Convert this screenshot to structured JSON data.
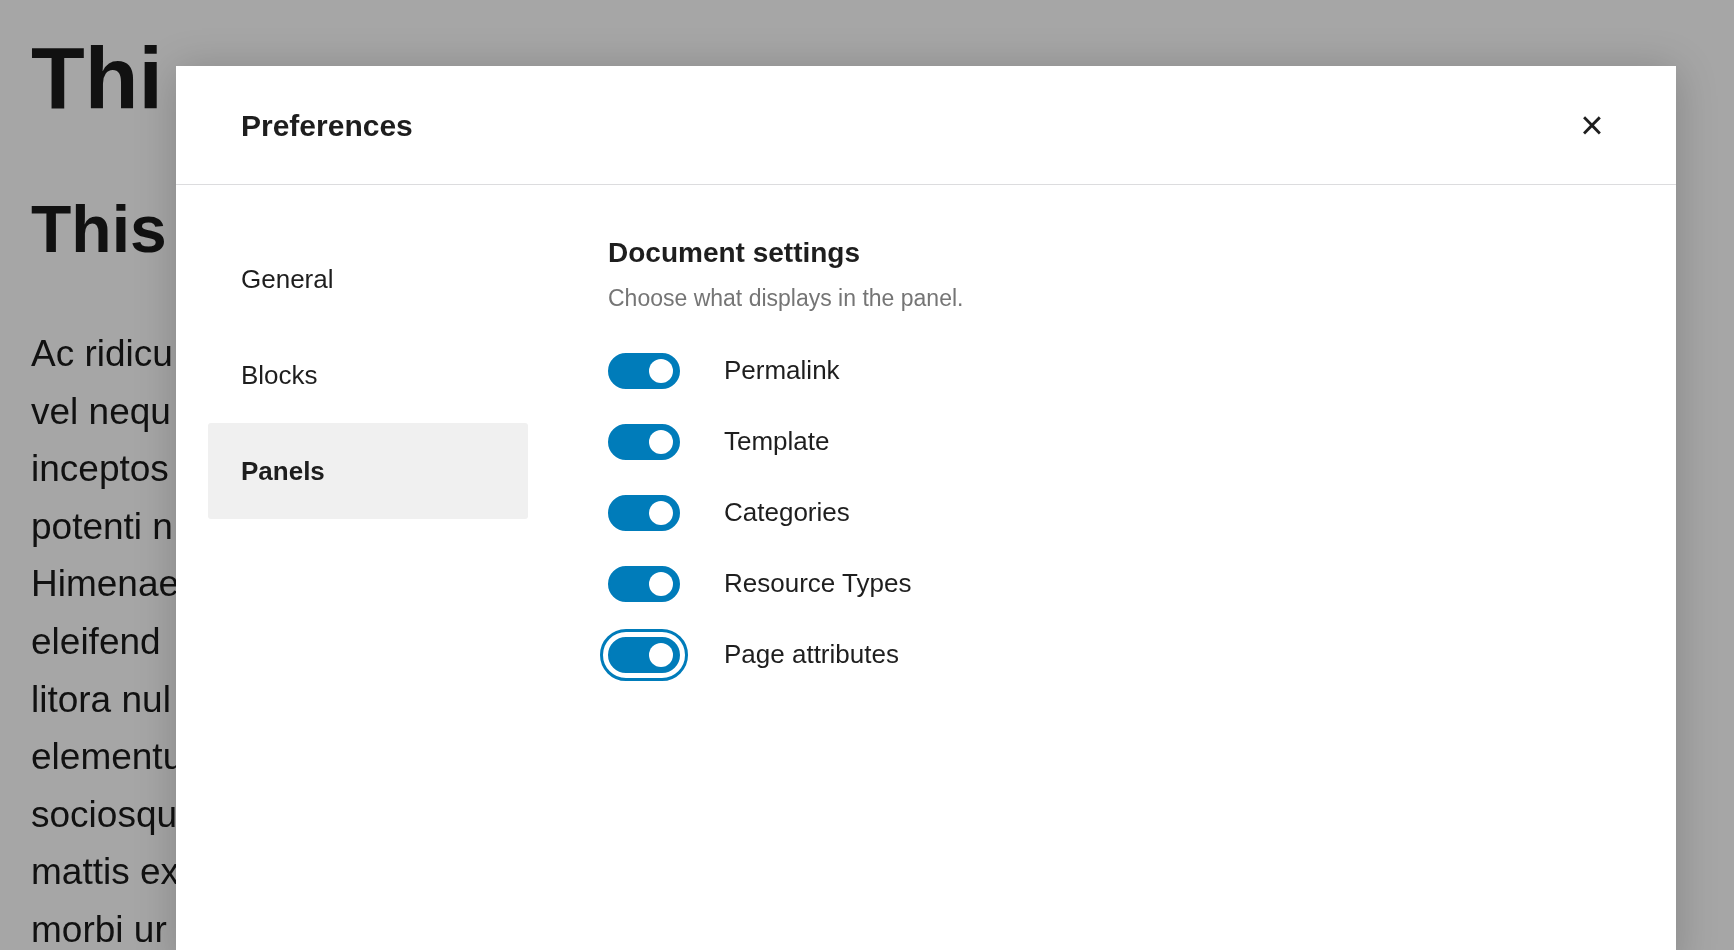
{
  "background_page": {
    "title": "Thi",
    "subtitle": "This",
    "paragraph_lines": [
      "Ac ridicu",
      "vel nequ",
      "inceptos",
      "potenti n",
      "Himenae",
      "eleifend",
      "litora nul",
      "elementu",
      "sociosqu",
      "mattis ex",
      "morbi ur"
    ]
  },
  "dialog": {
    "title": "Preferences",
    "close": "×",
    "tabs": [
      {
        "label": "General",
        "selected": false
      },
      {
        "label": "Blocks",
        "selected": false
      },
      {
        "label": "Panels",
        "selected": true
      }
    ],
    "section": {
      "heading": "Document settings",
      "description": "Choose what displays in the panel.",
      "toggles": [
        {
          "label": "Permalink",
          "on": true,
          "focused": false
        },
        {
          "label": "Template",
          "on": true,
          "focused": false
        },
        {
          "label": "Categories",
          "on": true,
          "focused": false
        },
        {
          "label": "Resource Types",
          "on": true,
          "focused": false
        },
        {
          "label": "Page attributes",
          "on": true,
          "focused": true
        }
      ]
    }
  }
}
